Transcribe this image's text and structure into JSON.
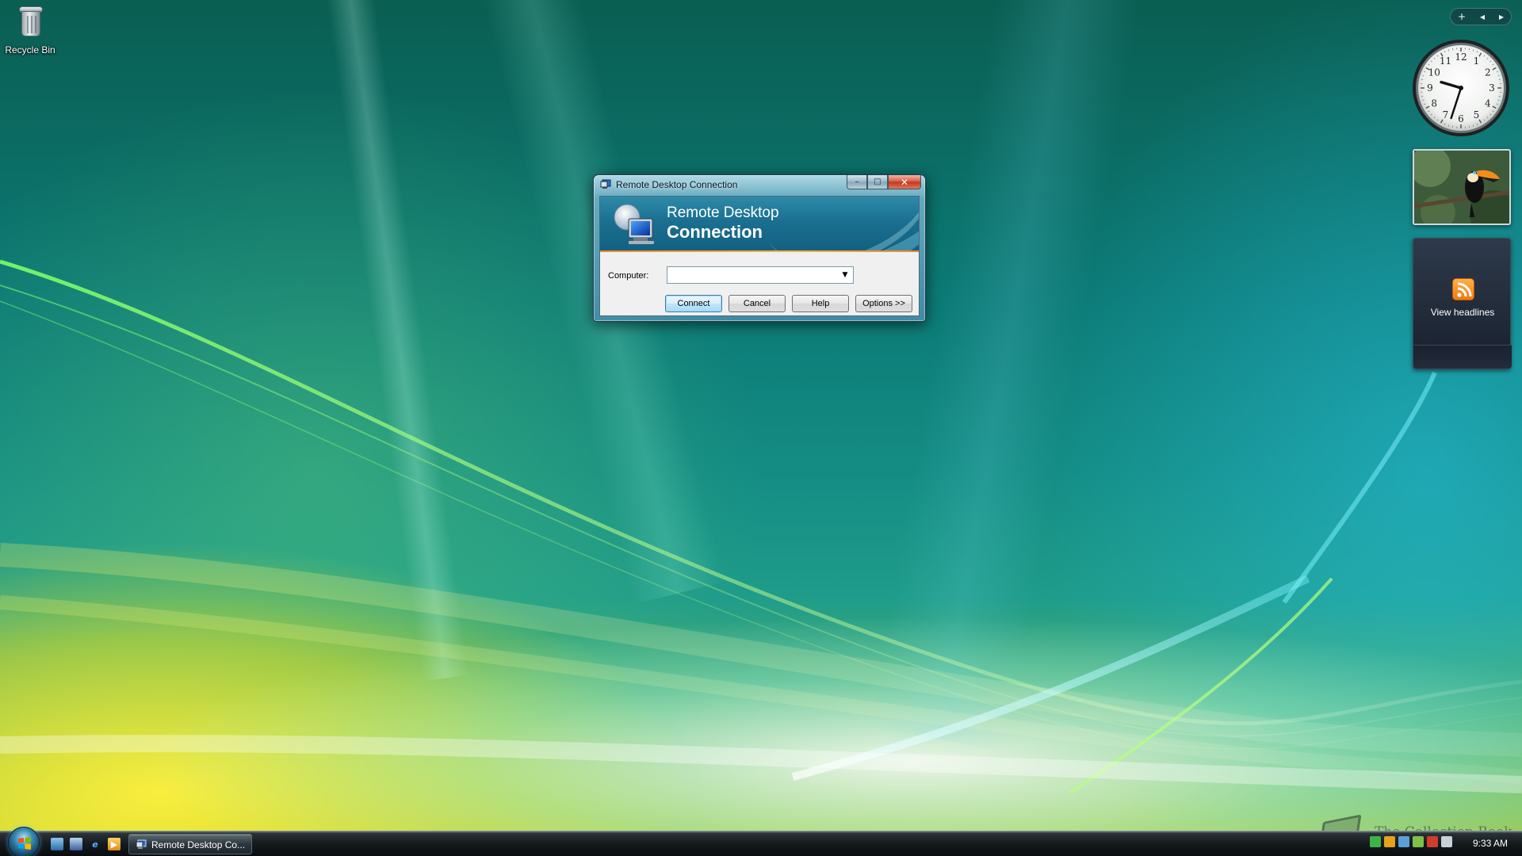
{
  "desktop": {
    "icons": [
      {
        "label": "Recycle Bin",
        "icon": "recycle-bin-icon"
      }
    ]
  },
  "sidebar": {
    "controls": {
      "add": "+",
      "prev": "◂",
      "next": "▸"
    },
    "clock": {
      "numerals": [
        "12",
        "1",
        "2",
        "3",
        "4",
        "5",
        "6",
        "7",
        "8",
        "9",
        "10",
        "11"
      ],
      "time": "9:33"
    },
    "slideshow": {
      "subject": "toucan"
    },
    "feed": {
      "link_label": "View headlines",
      "icon": "rss-icon"
    }
  },
  "dialog": {
    "title": "Remote Desktop Connection",
    "banner_line1": "Remote Desktop",
    "banner_line2": "Connection",
    "computer_label": "Computer:",
    "computer_value": "",
    "buttons": {
      "connect": "Connect",
      "cancel": "Cancel",
      "help": "Help",
      "options": "Options >>"
    },
    "window_buttons": {
      "minimize": "–",
      "maximize": "□",
      "close": "✕"
    }
  },
  "taskbar": {
    "quick_launch": [
      "show-desktop-icon",
      "switch-windows-icon",
      "internet-explorer-icon",
      "media-player-icon"
    ],
    "tasks": [
      {
        "label": "Remote Desktop Co...",
        "icon": "remote-desktop-icon",
        "active": true
      }
    ],
    "clock": "9:33 AM"
  },
  "watermark": {
    "text": "The Collection Book"
  },
  "colors": {
    "accent": "#1a6f90",
    "banner_stripe": "#e98a2c",
    "taskbar": "#151a1d",
    "rss": "#f07a12"
  }
}
